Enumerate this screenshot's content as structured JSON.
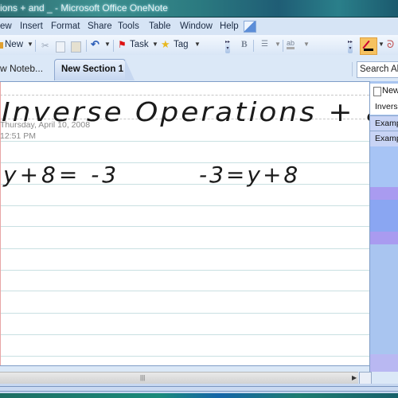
{
  "window": {
    "title": "ions + and _ - Microsoft Office OneNote"
  },
  "menu": [
    {
      "label": "ew",
      "underline": ""
    },
    {
      "label": "Insert"
    },
    {
      "label": "Format"
    },
    {
      "label": "Share"
    },
    {
      "label": "Tools"
    },
    {
      "label": "Table"
    },
    {
      "label": "Window"
    },
    {
      "label": "Help"
    }
  ],
  "toolbar": {
    "new_label": "New",
    "task_label": "Task",
    "tag_label": "Tag",
    "bold_label": "B"
  },
  "tabs": {
    "notebook_label": "w Noteb...",
    "section_label": "New Section 1"
  },
  "search": {
    "placeholder": "Search All N"
  },
  "page": {
    "title_ink": "Inverse Operations + and -",
    "date": "Thursday, April 10, 2008",
    "time": "12:51 PM",
    "equation_left": "y+8= -3",
    "equation_right": "-3=y+8"
  },
  "page_list": {
    "new_page_label": "New",
    "items": [
      {
        "label": "Inverse",
        "active": true
      },
      {
        "label": "Examp"
      },
      {
        "label": "Examp"
      }
    ]
  }
}
